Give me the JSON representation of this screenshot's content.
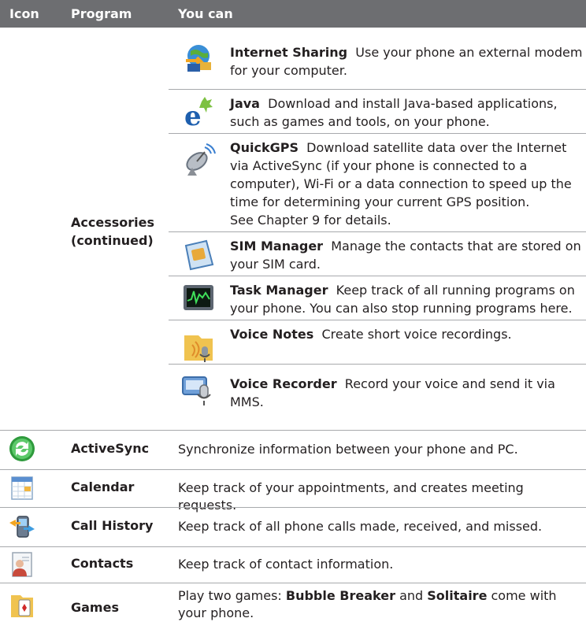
{
  "header": {
    "col_icon": "Icon",
    "col_program": "Program",
    "col_you_can": "You can"
  },
  "accessories": {
    "label_line1": "Accessories",
    "label_line2": "(continued)",
    "items": [
      {
        "name": "Internet Sharing",
        "desc": "Use your phone an external modem for your computer.",
        "icon": "internet-sharing-icon"
      },
      {
        "name": "Java",
        "desc": "Download and install Java-based applications, such as games and tools, on your phone.",
        "icon": "java-icon"
      },
      {
        "name": "QuickGPS",
        "desc": "Download satellite data over the Internet via ActiveSync (if your phone is connected to a computer), Wi-Fi or a data connection to speed up the time for determining your current GPS position.",
        "desc2": "See Chapter 9 for details.",
        "icon": "satellite-dish-icon"
      },
      {
        "name": "SIM Manager",
        "desc": "Manage the contacts that are stored on your SIM card.",
        "icon": "sim-card-icon"
      },
      {
        "name": "Task Manager",
        "desc": "Keep track of all running programs on your phone. You can also stop running programs here.",
        "icon": "task-manager-icon"
      },
      {
        "name": "Voice Notes",
        "desc": "Create short voice recordings.",
        "icon": "voice-notes-icon"
      },
      {
        "name": "Voice Recorder",
        "desc": "Record your voice and send it via MMS.",
        "icon": "voice-recorder-icon"
      }
    ]
  },
  "programs": [
    {
      "name": "ActiveSync",
      "desc": "Synchronize information between your phone and PC.",
      "icon": "sync-icon"
    },
    {
      "name": "Calendar",
      "desc": "Keep track of your appointments, and creates meeting requests.",
      "icon": "calendar-icon"
    },
    {
      "name": "Call History",
      "desc": "Keep track of all phone calls made, received, and missed.",
      "icon": "call-history-icon"
    },
    {
      "name": "Contacts",
      "desc": "Keep track of contact information.",
      "icon": "contacts-icon"
    },
    {
      "name": "Games",
      "desc_pre": "Play two games: ",
      "desc_b1": "Bubble Breaker",
      "desc_mid": " and ",
      "desc_b2": "Solitaire",
      "desc_post": " come with your phone.",
      "icon": "games-icon"
    }
  ]
}
